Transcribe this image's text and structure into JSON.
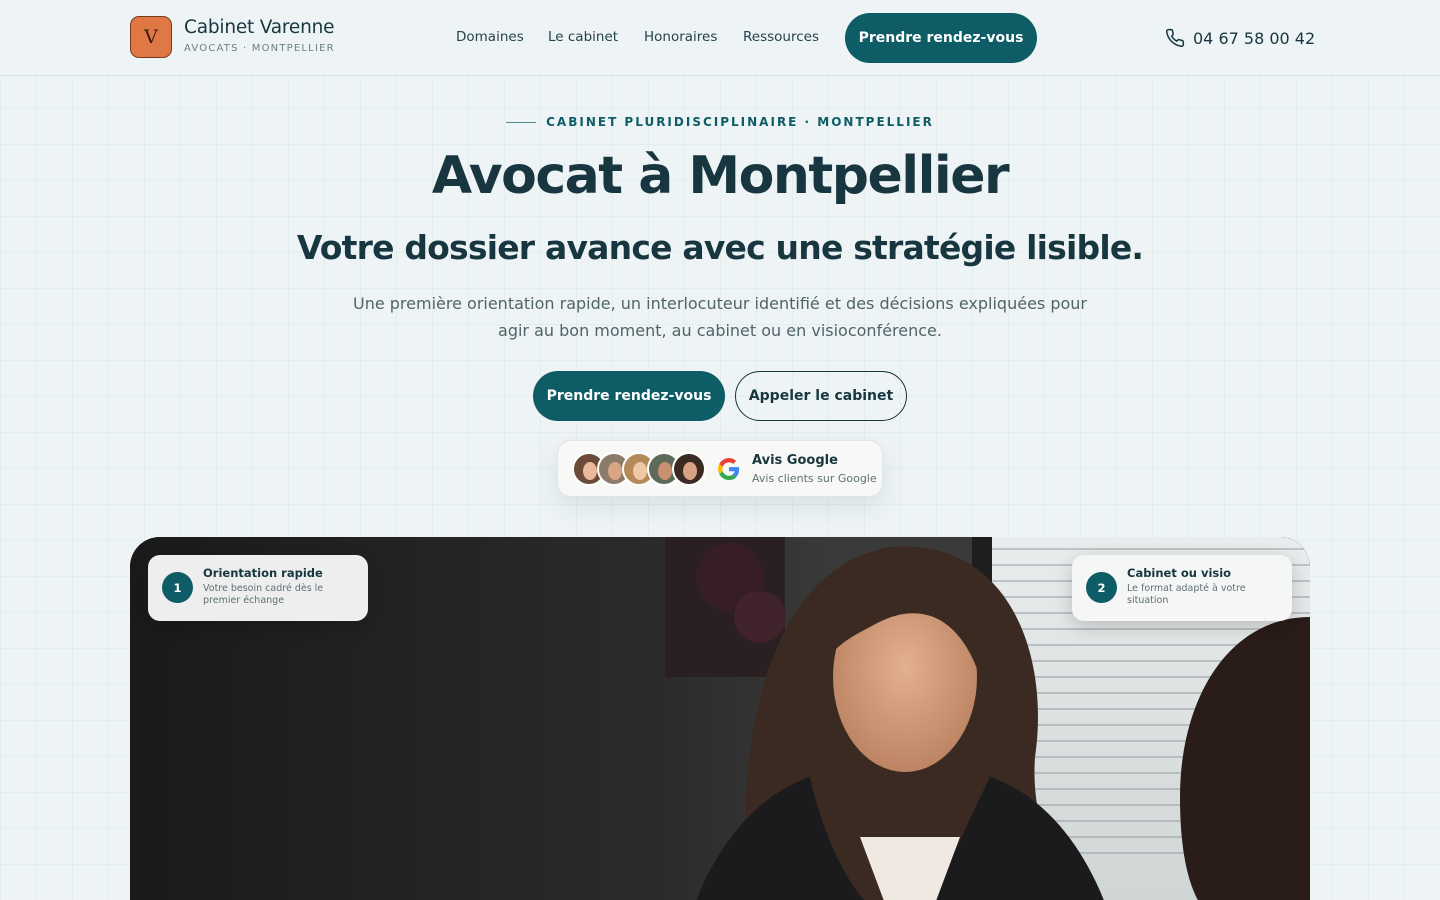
{
  "header": {
    "logo_letter": "V",
    "brand_name": "Cabinet Varenne",
    "brand_sub": "AVOCATS · MONTPELLIER",
    "nav": [
      {
        "label": "Domaines"
      },
      {
        "label": "Le cabinet"
      },
      {
        "label": "Honoraires"
      },
      {
        "label": "Ressources"
      }
    ],
    "cta_label": "Prendre rendez-vous",
    "phone_icon": "phone-icon",
    "phone_number": "04 67 58 00 42"
  },
  "hero": {
    "eyebrow": "CABINET PLURIDISCIPLINAIRE · MONTPELLIER",
    "title": "Avocat à Montpellier",
    "subtitle": "Votre dossier avance avec une stratégie lisible.",
    "description": "Une première orientation rapide, un interlocuteur identifié et des décisions expliquées pour agir au bon moment, au cabinet ou en visioconférence.",
    "primary_button": "Prendre rendez-vous",
    "secondary_button": "Appeler le cabinet"
  },
  "reviews": {
    "title": "Avis Google",
    "subtitle": "Avis clients sur Google",
    "icon": "google-g-icon",
    "avatar_count": 5
  },
  "photo": {
    "steps": [
      {
        "number": "1",
        "title": "Orientation rapide",
        "text": "Votre besoin cadré dès le premier échange"
      },
      {
        "number": "2",
        "title": "Cabinet ou visio",
        "text": "Le format adapté à votre situation"
      }
    ]
  },
  "colors": {
    "accent": "#0e5d66",
    "logo": "#e07845",
    "text": "#173640",
    "background": "#eef4f5"
  }
}
